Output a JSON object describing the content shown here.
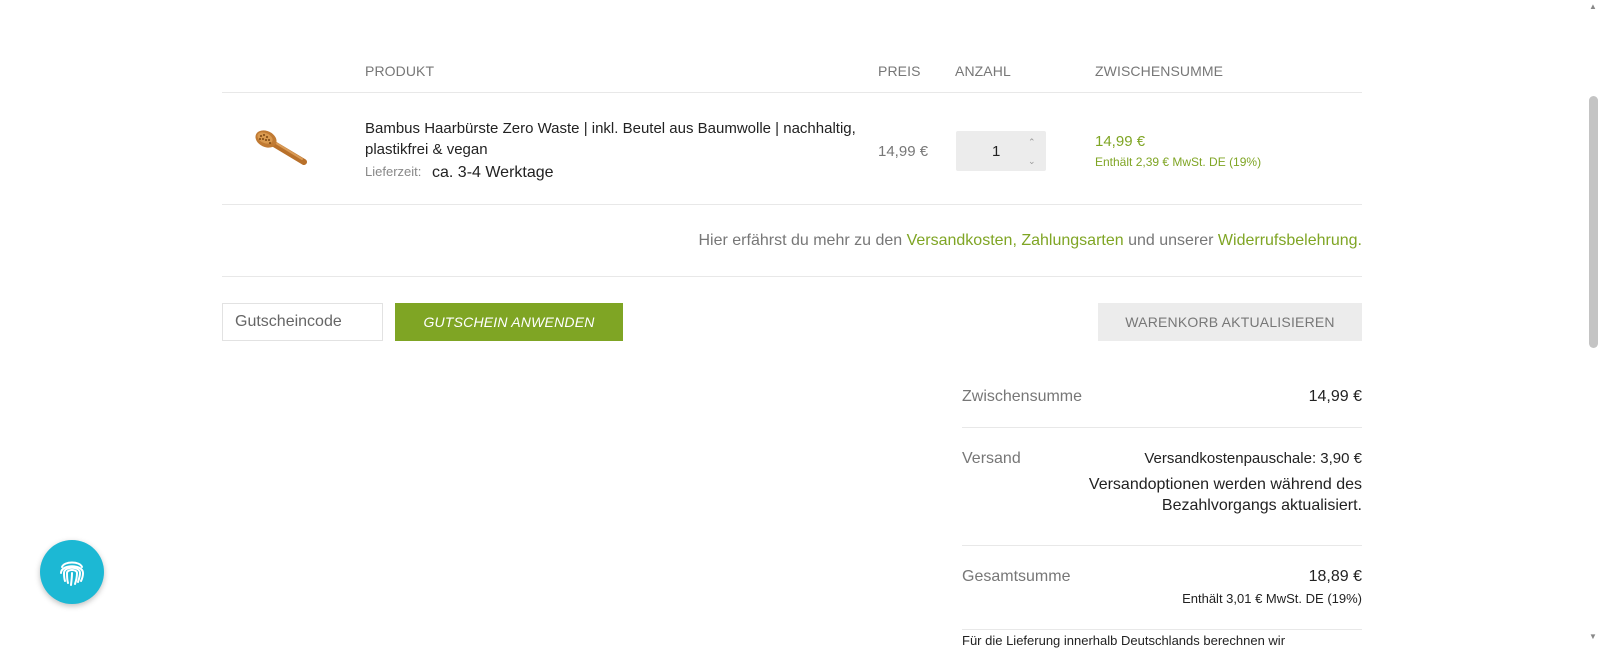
{
  "table": {
    "headers": {
      "produkt": "PRODUKT",
      "preis": "PREIS",
      "anzahl": "ANZAHL",
      "zwischensumme": "ZWISCHENSUMME"
    }
  },
  "item": {
    "image_icon": "hairbrush-image",
    "title": "Bambus Haarbürste Zero Waste | inkl. Beutel aus Baumwolle | nachhaltig, plastikfrei & vegan",
    "delivery_label": "Lieferzeit:",
    "delivery_value": "ca. 3-4 Werktage",
    "price": "14,99 €",
    "quantity": "1",
    "subtotal": "14,99 €",
    "subtotal_tax": "Enthält 2,39 € MwSt. DE (19%)"
  },
  "info": {
    "prefix": "Hier erfährst du mehr zu den ",
    "link_shipping": "Versandkosten",
    "comma": ", ",
    "link_payment": "Zahlungsarten",
    "middle": " und unserer ",
    "link_withdrawal": "Widerrufsbelehrung."
  },
  "coupon": {
    "placeholder": "Gutscheincode",
    "apply_label": "GUTSCHEIN ANWENDEN",
    "update_label": "WARENKORB AKTUALISIEREN"
  },
  "totals": {
    "subtotal_label": "Zwischensumme",
    "subtotal_value": "14,99 €",
    "shipping_label": "Versand",
    "shipping_rate": "Versandkostenpauschale: 3,90 €",
    "shipping_note": "Versandoptionen werden während des Bezahlvorgangs aktualisiert.",
    "total_label": "Gesamtsumme",
    "total_value": "18,89 €",
    "total_tax": "Enthält 3,01 € MwSt. DE (19%)",
    "footer_text": "Für die Lieferung innerhalb Deutschlands berechnen wir"
  },
  "widgets": {
    "fab_icon": "fingerprint-icon"
  },
  "colors": {
    "accent": "#7fa524",
    "fab": "#1cb8d4"
  }
}
